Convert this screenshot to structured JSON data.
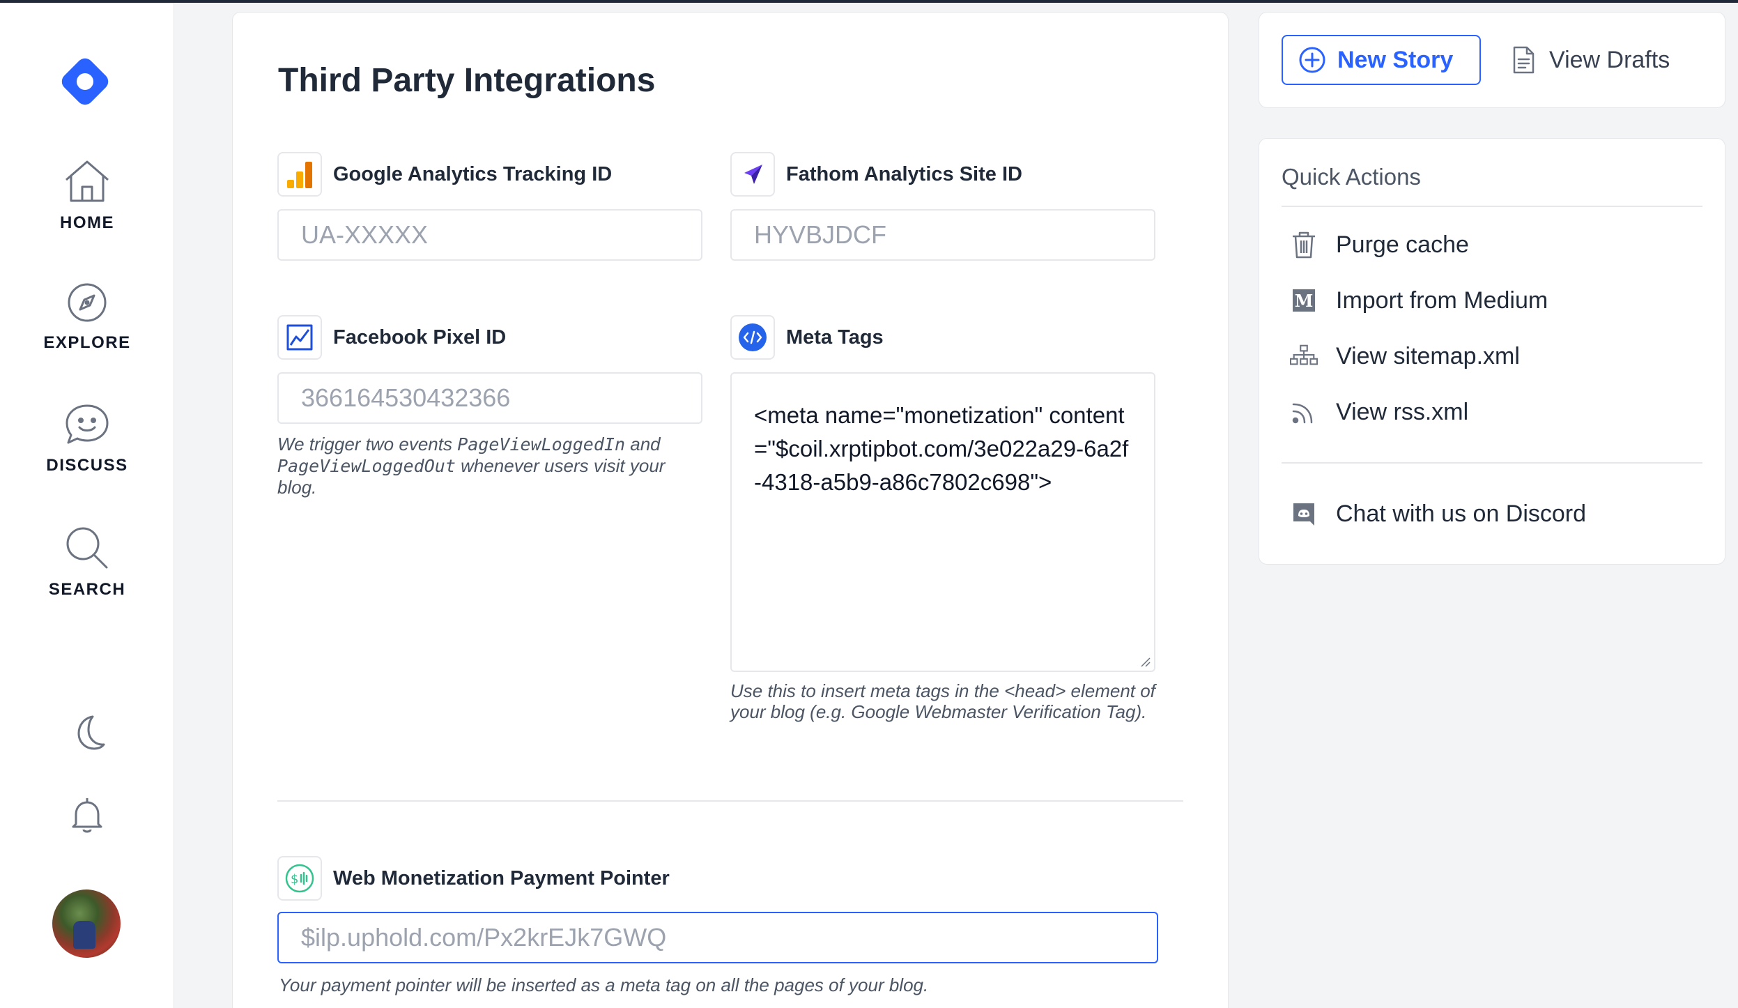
{
  "nav": {
    "items": [
      {
        "label": "HOME"
      },
      {
        "label": "EXPLORE"
      },
      {
        "label": "DISCUSS"
      },
      {
        "label": "SEARCH"
      }
    ]
  },
  "main": {
    "title": "Third Party Integrations",
    "fields": {
      "google": {
        "label": "Google Analytics Tracking ID",
        "placeholder": "UA-XXXXX"
      },
      "fathom": {
        "label": "Fathom Analytics Site ID",
        "placeholder": "HYVBJDCF"
      },
      "facebook": {
        "label": "Facebook Pixel ID",
        "placeholder": "366164530432366",
        "help_prefix": "We trigger two events ",
        "help_code1": "PageViewLoggedIn",
        "help_and": " and ",
        "help_code2": "PageViewLoggedOut",
        "help_suffix": " whenever users visit your blog."
      },
      "meta": {
        "label": "Meta Tags",
        "value": "<meta name=\"monetization\" content=\"$coil.xrptipbot.com/3e022a29-6a2f-4318-a5b9-a86c7802c698\">",
        "help": "Use this to insert meta tags in the <head> element of your blog (e.g. Google Webmaster Verification Tag)."
      },
      "monetization": {
        "label": "Web Monetization Payment Pointer",
        "placeholder": "$ilp.uphold.com/Px2krEJk7GWQ",
        "help": "Your payment pointer will be inserted as a meta tag on all the pages of your blog."
      }
    }
  },
  "actions": {
    "new_story": "New Story",
    "view_drafts": "View Drafts"
  },
  "quick_actions": {
    "title": "Quick Actions",
    "items": [
      {
        "label": "Purge cache",
        "icon": "trash-icon"
      },
      {
        "label": "Import from Medium",
        "icon": "medium-icon"
      },
      {
        "label": "View sitemap.xml",
        "icon": "sitemap-icon"
      },
      {
        "label": "View rss.xml",
        "icon": "rss-icon"
      }
    ],
    "discord": "Chat with us on Discord"
  },
  "colors": {
    "accent": "#2962ff",
    "background": "#f3f4f6",
    "border": "#e5e7eb"
  }
}
